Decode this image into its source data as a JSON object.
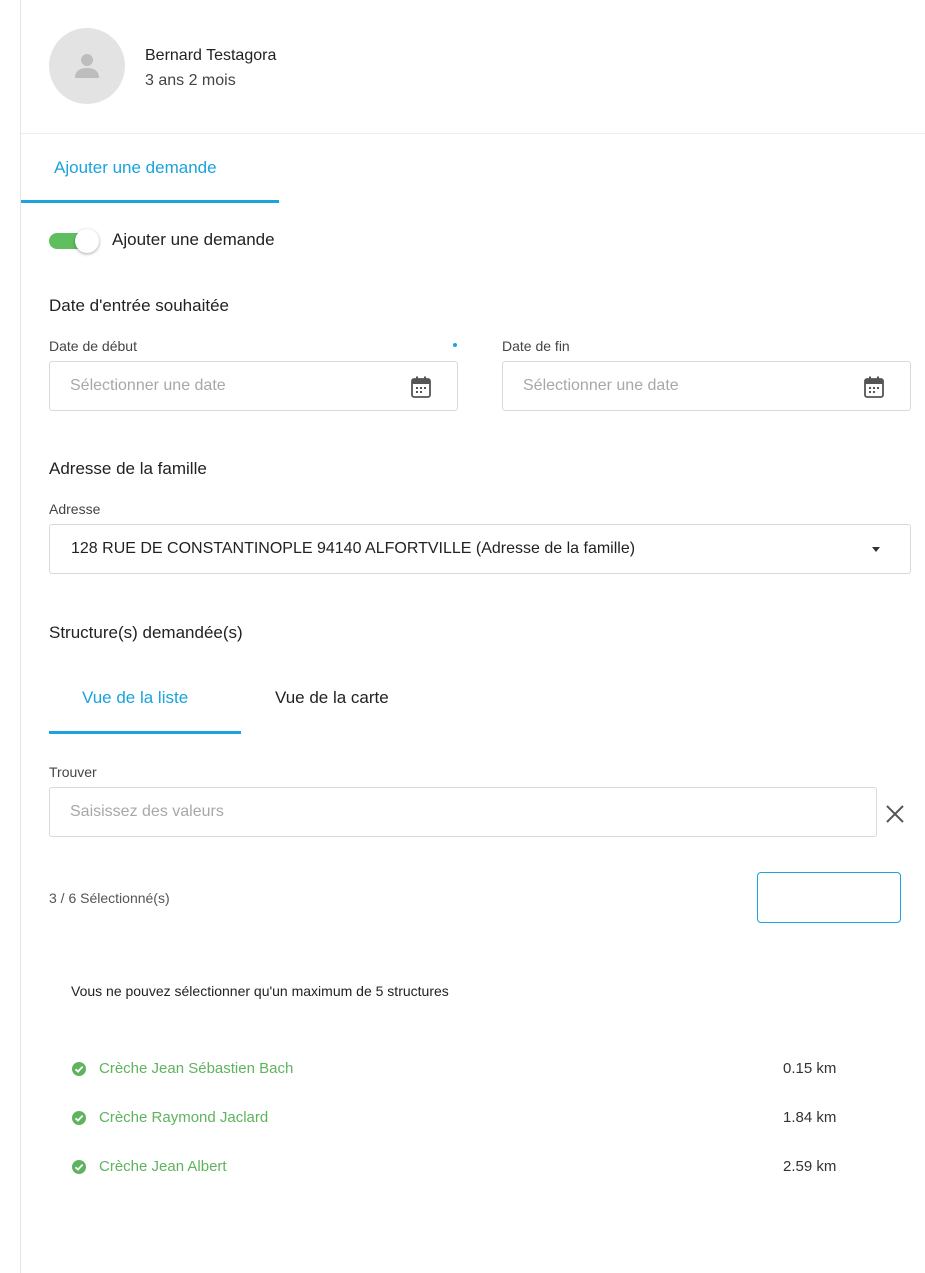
{
  "child": {
    "name": "Bernard Testagora",
    "age": "3 ans 2 mois"
  },
  "main_tab": {
    "label": "Ajouter une demande"
  },
  "toggle": {
    "label": "Ajouter une demande",
    "on": true,
    "color": "#5fbf5f"
  },
  "dates": {
    "section_title": "Date d'entrée souhaitée",
    "start_label": "Date de début",
    "start_placeholder": "Sélectionner une date",
    "end_label": "Date de fin",
    "end_placeholder": "Sélectionner une date"
  },
  "address": {
    "section_title": "Adresse de la famille",
    "label": "Adresse",
    "value": "128 RUE DE CONSTANTINOPLE 94140 ALFORTVILLE (Adresse de la famille)"
  },
  "structures": {
    "section_title": "Structure(s) demandée(s)",
    "tabs": [
      {
        "label": "Vue de la liste",
        "active": true
      },
      {
        "label": "Vue de la carte",
        "active": false
      }
    ],
    "search_label": "Trouver",
    "search_placeholder": "Saisissez des valeurs",
    "selected_count": "3 / 6 Sélectionné(s)",
    "warning": "Vous ne pouvez sélectionner qu'un maximum de 5 structures",
    "items": [
      {
        "name": "Crèche Jean Sébastien Bach",
        "distance": "0.15 km"
      },
      {
        "name": "Crèche Raymond Jaclard",
        "distance": "1.84 km"
      },
      {
        "name": "Crèche Jean Albert",
        "distance": "2.59 km"
      }
    ]
  },
  "colors": {
    "accent": "#1aa3dc",
    "success": "#5fb35f"
  },
  "icons": {
    "avatar": "person-icon",
    "calendar": "calendar-icon",
    "clear": "close-icon",
    "dropdown": "caret-down-icon",
    "selected": "check-circle-icon"
  }
}
